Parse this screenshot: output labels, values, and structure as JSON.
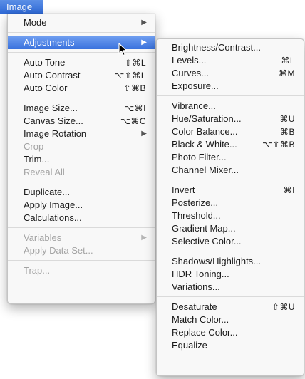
{
  "menubar": {
    "title": "Image"
  },
  "image_menu": {
    "groups": [
      [
        {
          "label": "Mode",
          "submenu": true
        }
      ],
      [
        {
          "label": "Adjustments",
          "submenu": true,
          "highlight": true
        }
      ],
      [
        {
          "label": "Auto Tone",
          "shortcut": "⇧⌘L"
        },
        {
          "label": "Auto Contrast",
          "shortcut": "⌥⇧⌘L"
        },
        {
          "label": "Auto Color",
          "shortcut": "⇧⌘B"
        }
      ],
      [
        {
          "label": "Image Size...",
          "shortcut": "⌥⌘I"
        },
        {
          "label": "Canvas Size...",
          "shortcut": "⌥⌘C"
        },
        {
          "label": "Image Rotation",
          "submenu": true
        },
        {
          "label": "Crop",
          "disabled": true
        },
        {
          "label": "Trim..."
        },
        {
          "label": "Reveal All",
          "disabled": true
        }
      ],
      [
        {
          "label": "Duplicate..."
        },
        {
          "label": "Apply Image..."
        },
        {
          "label": "Calculations..."
        }
      ],
      [
        {
          "label": "Variables",
          "submenu": true,
          "disabled": true
        },
        {
          "label": "Apply Data Set...",
          "disabled": true
        }
      ],
      [
        {
          "label": "Trap...",
          "disabled": true
        }
      ]
    ]
  },
  "adjustments_menu": {
    "groups": [
      [
        {
          "label": "Brightness/Contrast..."
        },
        {
          "label": "Levels...",
          "shortcut": "⌘L"
        },
        {
          "label": "Curves...",
          "shortcut": "⌘M"
        },
        {
          "label": "Exposure..."
        }
      ],
      [
        {
          "label": "Vibrance..."
        },
        {
          "label": "Hue/Saturation...",
          "shortcut": "⌘U"
        },
        {
          "label": "Color Balance...",
          "shortcut": "⌘B"
        },
        {
          "label": "Black & White...",
          "shortcut": "⌥⇧⌘B"
        },
        {
          "label": "Photo Filter..."
        },
        {
          "label": "Channel Mixer..."
        }
      ],
      [
        {
          "label": "Invert",
          "shortcut": "⌘I"
        },
        {
          "label": "Posterize..."
        },
        {
          "label": "Threshold..."
        },
        {
          "label": "Gradient Map..."
        },
        {
          "label": "Selective Color..."
        }
      ],
      [
        {
          "label": "Shadows/Highlights..."
        },
        {
          "label": "HDR Toning..."
        },
        {
          "label": "Variations..."
        }
      ],
      [
        {
          "label": "Desaturate",
          "shortcut": "⇧⌘U"
        },
        {
          "label": "Match Color..."
        },
        {
          "label": "Replace Color..."
        },
        {
          "label": "Equalize"
        }
      ]
    ]
  },
  "colors": {
    "highlight": "#3a72dd",
    "disabled_text": "#a3a3a3"
  },
  "icons": {
    "submenu": "triangle-right-icon",
    "cursor": "arrow-cursor-icon"
  }
}
